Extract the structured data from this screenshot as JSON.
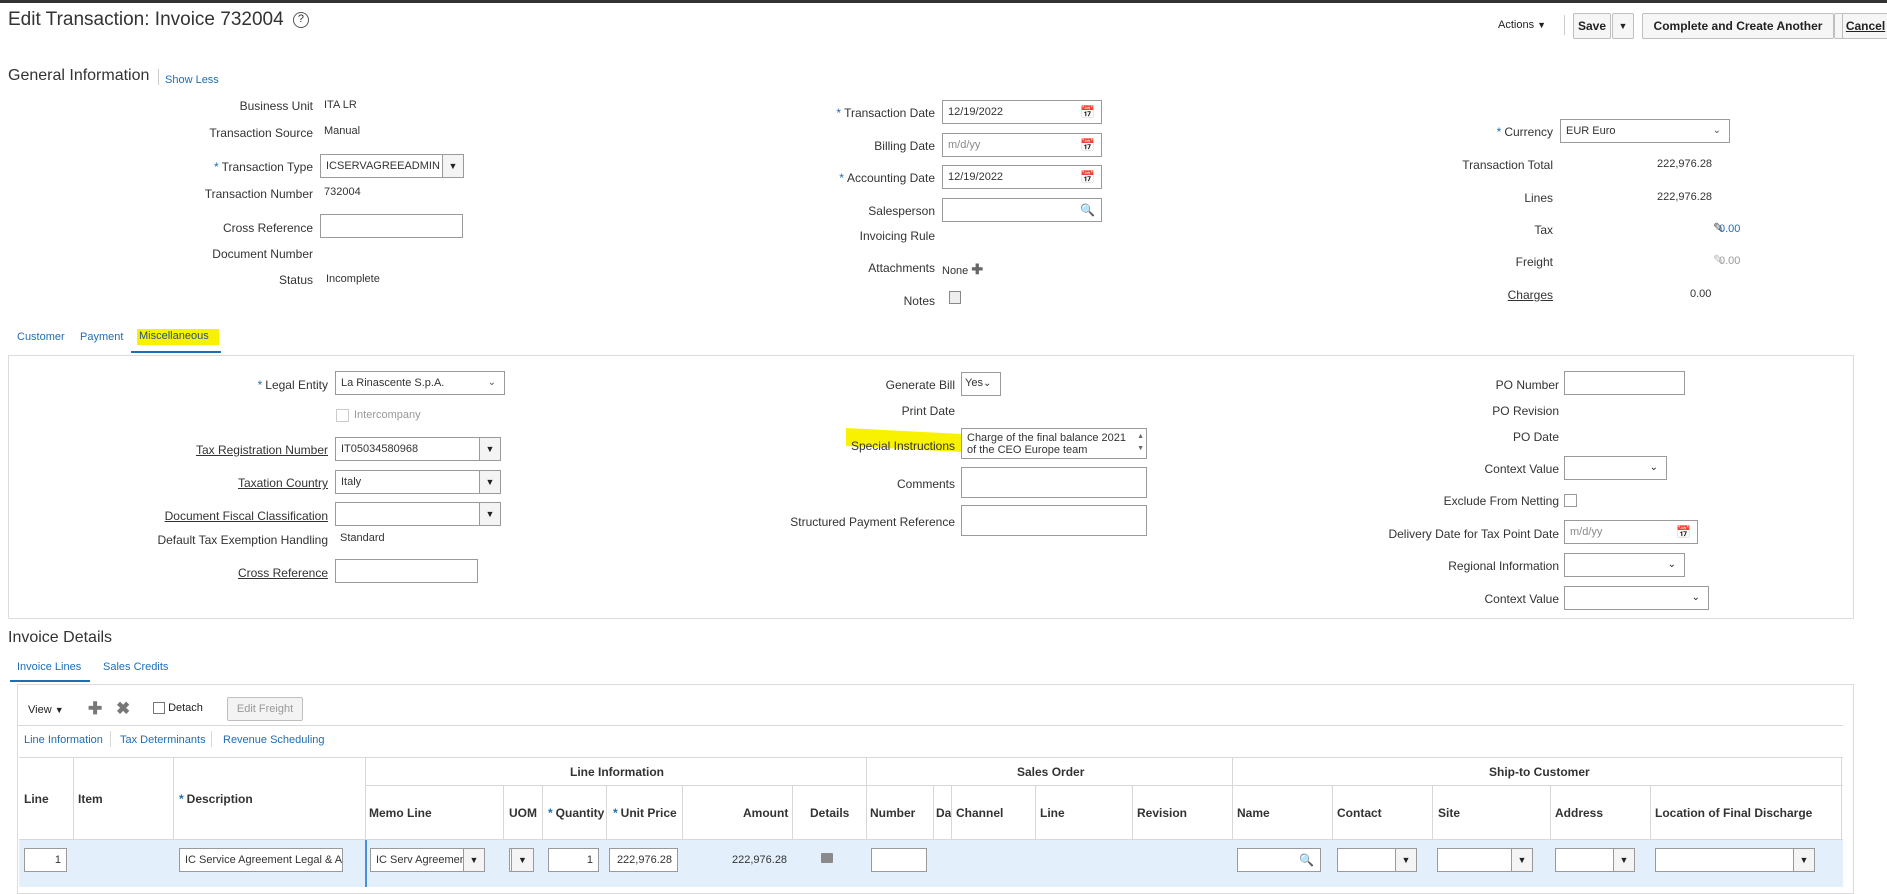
{
  "header": {
    "title": "Edit Transaction: Invoice 732004",
    "help_icon": "?",
    "actions_label": "Actions",
    "save_label": "Save",
    "complete_create_label": "Complete and Create Another",
    "cancel_label": "Cancel"
  },
  "general": {
    "section_title": "General Information",
    "show_less": "Show Less",
    "business_unit_label": "Business Unit",
    "business_unit": "ITA LR",
    "transaction_source_label": "Transaction Source",
    "transaction_source": "Manual",
    "transaction_type_label": "Transaction Type",
    "transaction_type": "ICSERVAGREEADMIN",
    "transaction_number_label": "Transaction Number",
    "transaction_number": "732004",
    "cross_reference_label": "Cross Reference",
    "cross_reference": "",
    "document_number_label": "Document Number",
    "status_label": "Status",
    "status": "Incomplete",
    "transaction_date_label": "Transaction Date",
    "transaction_date": "12/19/2022",
    "billing_date_label": "Billing Date",
    "billing_date_placeholder": "m/d/yy",
    "accounting_date_label": "Accounting Date",
    "accounting_date": "12/19/2022",
    "salesperson_label": "Salesperson",
    "invoicing_rule_label": "Invoicing Rule",
    "attachments_label": "Attachments",
    "attachments": "None",
    "notes_label": "Notes",
    "currency_label": "Currency",
    "currency": "EUR Euro",
    "transaction_total_label": "Transaction Total",
    "transaction_total": "222,976.28",
    "lines_label": "Lines",
    "lines": "222,976.28",
    "tax_label": "Tax",
    "tax": "0.00",
    "freight_label": "Freight",
    "freight": "0.00",
    "charges_label": "Charges",
    "charges": "0.00"
  },
  "tabs": {
    "customer": "Customer",
    "payment": "Payment",
    "miscellaneous": "Miscellaneous"
  },
  "misc": {
    "legal_entity_label": "Legal Entity",
    "legal_entity": "La Rinascente S.p.A.",
    "intercompany_label": "Intercompany",
    "tax_reg_label": "Tax Registration Number",
    "tax_reg": "IT05034580968",
    "taxation_country_label": "Taxation Country",
    "taxation_country": "Italy",
    "doc_fiscal_label": "Document Fiscal Classification",
    "doc_fiscal": "",
    "default_tax_label": "Default Tax Exemption Handling",
    "default_tax": "Standard",
    "cross_ref_label": "Cross Reference",
    "generate_bill_label": "Generate Bill",
    "generate_bill": "Yes",
    "print_date_label": "Print Date",
    "special_instr_label": "Special Instructions",
    "special_instr_line1": "Charge of the final balance 2021",
    "special_instr_line2": "of the CEO Europe team",
    "comments_label": "Comments",
    "structured_ref_label": "Structured Payment Reference",
    "po_number_label": "PO Number",
    "po_revision_label": "PO Revision",
    "po_date_label": "PO Date",
    "context_value_label": "Context Value",
    "exclude_netting_label": "Exclude From Netting",
    "delivery_date_label": "Delivery Date for Tax Point Date",
    "delivery_date_placeholder": "m/d/yy",
    "regional_info_label": "Regional Information",
    "context_value2_label": "Context Value"
  },
  "invoice": {
    "section_title": "Invoice Details",
    "tab_lines": "Invoice Lines",
    "tab_sales_credits": "Sales Credits",
    "view_label": "View",
    "detach_label": "Detach",
    "edit_freight_label": "Edit Freight",
    "subtab_line_info": "Line Information",
    "subtab_tax_det": "Tax Determinants",
    "subtab_rev_sched": "Revenue Scheduling",
    "group_line_info": "Line Information",
    "group_sales_order": "Sales Order",
    "group_ship_to": "Ship-to Customer",
    "columns": {
      "line": "Line",
      "item": "Item",
      "description": "Description",
      "memo_line": "Memo Line",
      "uom": "UOM",
      "quantity": "Quantity",
      "unit_price": "Unit Price",
      "amount": "Amount",
      "details": "Details",
      "number": "Number",
      "da": "Da",
      "channel": "Channel",
      "so_line": "Line",
      "revision": "Revision",
      "name": "Name",
      "contact": "Contact",
      "site": "Site",
      "address": "Address",
      "location": "Location of Final Discharge"
    },
    "row": {
      "line": "1",
      "description": "IC Service Agreement Legal & A",
      "memo_line": "IC Serv Agreemen",
      "quantity": "1",
      "unit_price": "222,976.28",
      "amount": "222,976.28"
    }
  }
}
